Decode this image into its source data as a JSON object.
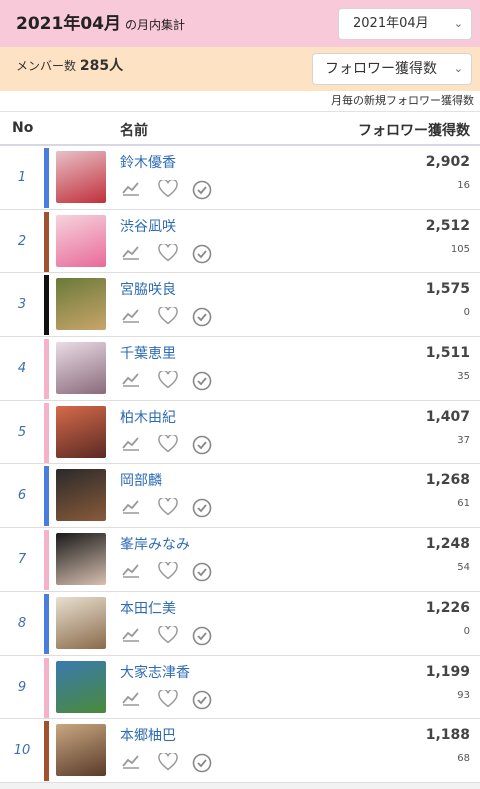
{
  "header": {
    "title": "2021年04月",
    "title_suffix": "の月内集計",
    "month_select": "2021年04月"
  },
  "members": {
    "label": "メンバー数",
    "count": "285人",
    "sort_select": "フォロワー獲得数"
  },
  "note": "月毎の新規フォロワー獲得数",
  "columns": {
    "no": "No",
    "name": "名前",
    "count": "フォロワー獲得数"
  },
  "rows": [
    {
      "rank": "1",
      "name": "鈴木優香",
      "count": "2,902",
      "sub": "16",
      "color": "#4a7de0"
    },
    {
      "rank": "2",
      "name": "渋谷凪咲",
      "count": "2,512",
      "sub": "105",
      "color": "#a0522d"
    },
    {
      "rank": "3",
      "name": "宮脇咲良",
      "count": "1,575",
      "sub": "0",
      "color": "#111111"
    },
    {
      "rank": "4",
      "name": "千葉恵里",
      "count": "1,511",
      "sub": "35",
      "color": "#f5b3c8"
    },
    {
      "rank": "5",
      "name": "柏木由紀",
      "count": "1,407",
      "sub": "37",
      "color": "#f5b3c8"
    },
    {
      "rank": "6",
      "name": "岡部麟",
      "count": "1,268",
      "sub": "61",
      "color": "#4a7de0"
    },
    {
      "rank": "7",
      "name": "峯岸みなみ",
      "count": "1,248",
      "sub": "54",
      "color": "#f5b3c8"
    },
    {
      "rank": "8",
      "name": "本田仁美",
      "count": "1,226",
      "sub": "0",
      "color": "#4a7de0"
    },
    {
      "rank": "9",
      "name": "大家志津香",
      "count": "1,199",
      "sub": "93",
      "color": "#f5b3c8"
    },
    {
      "rank": "10",
      "name": "本郷柚巴",
      "count": "1,188",
      "sub": "68",
      "color": "#a0522d"
    }
  ],
  "icons": [
    "chart-icon",
    "heart-icon",
    "check-circle-icon"
  ]
}
